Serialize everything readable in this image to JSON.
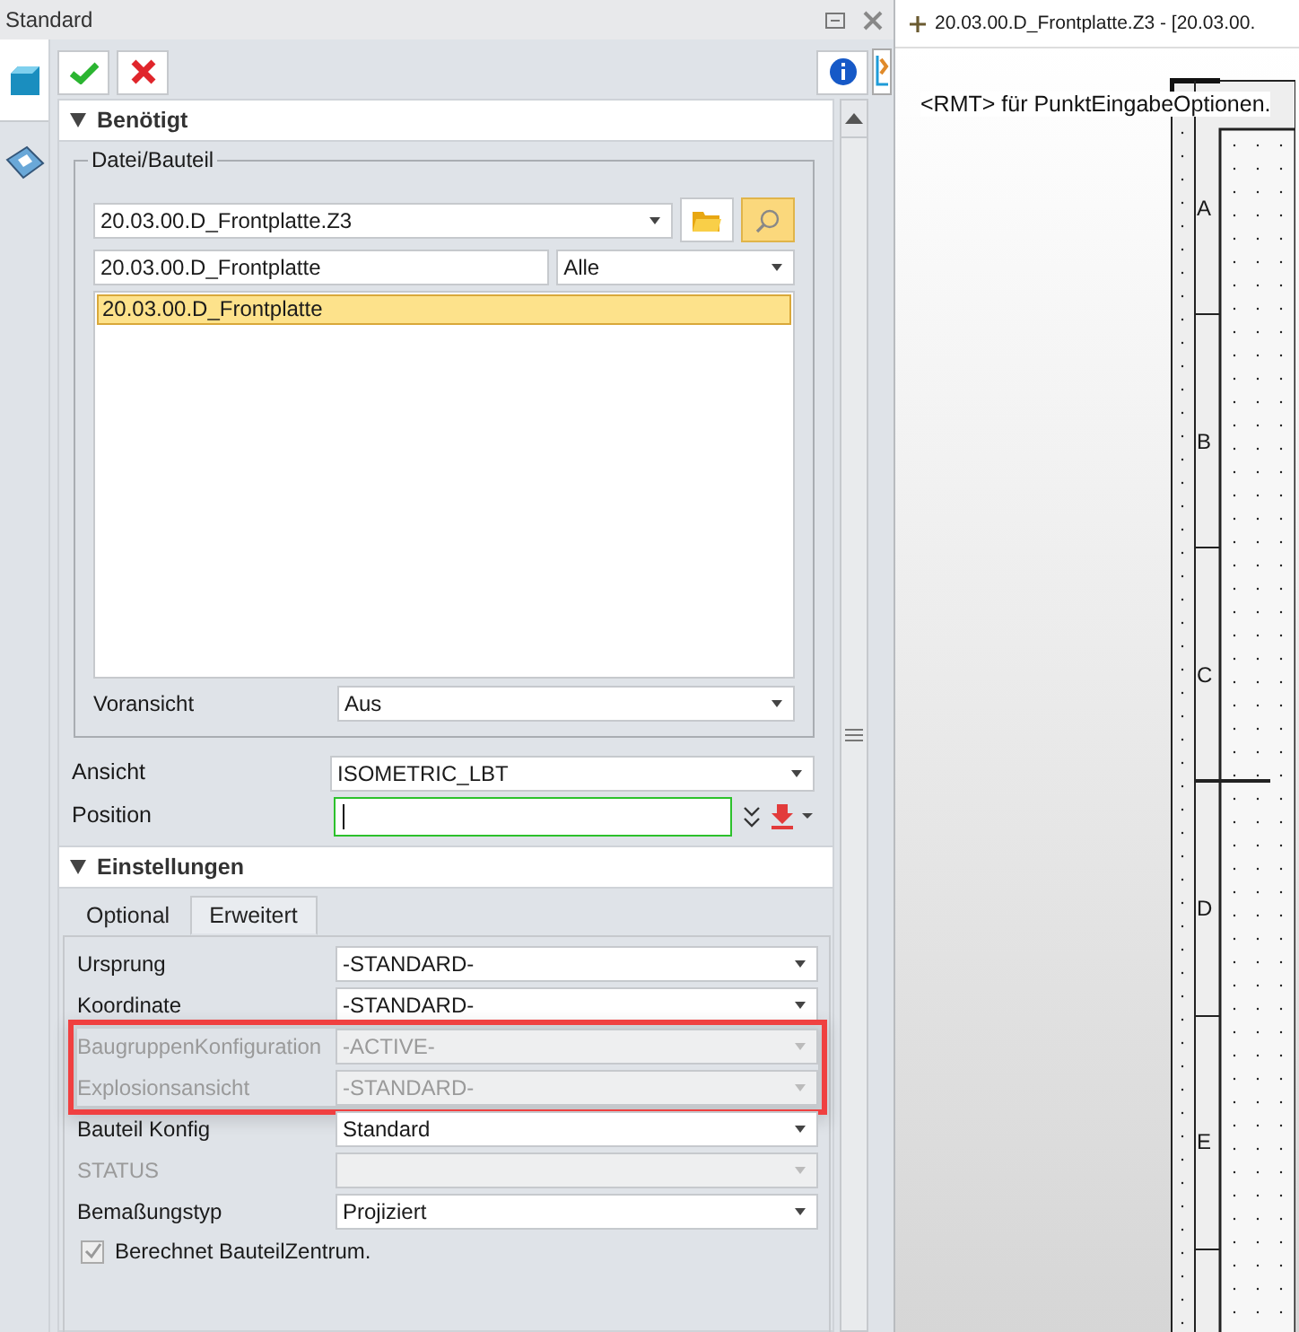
{
  "window": {
    "title": "Standard"
  },
  "required": {
    "title": "Benötigt",
    "expanded": true,
    "group_title": "Datei/Bauteil",
    "file_combo": "20.03.00.D_Frontplatte.Z3",
    "search_value": "20.03.00.D_Frontplatte",
    "filter_combo": "Alle",
    "results": [
      {
        "label": "20.03.00.D_Frontplatte",
        "selected": true
      }
    ],
    "preview": {
      "label": "Voransicht",
      "value": "Aus"
    },
    "fields": [
      {
        "label": "Ansicht",
        "kind": "combo",
        "value": "ISOMETRIC_LBT"
      },
      {
        "label": "Position",
        "kind": "input",
        "focused": true
      }
    ]
  },
  "settings": {
    "title": "Einstellungen",
    "expanded": true,
    "tabs": [
      {
        "label": "Optional",
        "selected": false
      },
      {
        "label": "Erweitert",
        "selected": true
      }
    ],
    "row_groups": [
      {
        "highlighted": false,
        "rows": [
          {
            "label": "Ursprung",
            "value": "-STANDARD-",
            "disabled": false
          },
          {
            "label": "Koordinate",
            "value": "-STANDARD-",
            "disabled": false
          }
        ]
      },
      {
        "highlighted": true,
        "rows": [
          {
            "label": "BaugruppenKonfiguration",
            "value": "-ACTIVE-",
            "disabled": true
          },
          {
            "label": "Explosionsansicht",
            "value": "-STANDARD-",
            "disabled": true
          }
        ]
      },
      {
        "highlighted": false,
        "rows": [
          {
            "label": "Bauteil Konfig",
            "value": "Standard",
            "disabled": false
          },
          {
            "label": "STATUS",
            "disabled": true
          },
          {
            "label": "Bemaßungstyp",
            "value": "Projiziert",
            "disabled": false
          }
        ]
      }
    ],
    "checkbox": {
      "label": "Berechnet BauteilZentrum.",
      "checked": true,
      "disabled": true
    }
  },
  "document": {
    "tab_title": "20.03.00.D_Frontplatte.Z3 - [20.03.00.",
    "hint": "<RMT> für PunktEingabeOptionen.",
    "zones": [
      "A",
      "B",
      "C",
      "D",
      "E"
    ]
  }
}
